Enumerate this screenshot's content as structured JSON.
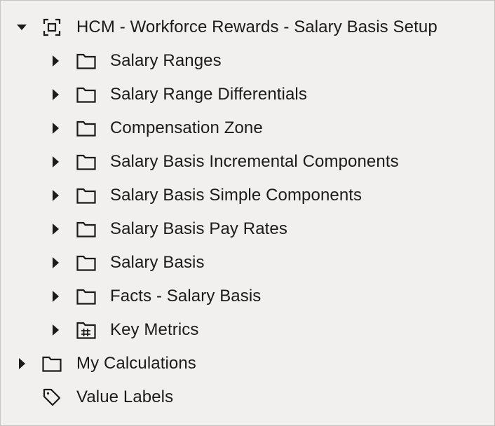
{
  "tree": {
    "root": {
      "label": "HCM - Workforce Rewards - Salary Basis Setup",
      "expanded": true,
      "icon": "subject-area-icon",
      "children": [
        {
          "label": "Salary Ranges",
          "icon": "folder-icon",
          "expanded": false
        },
        {
          "label": "Salary Range Differentials",
          "icon": "folder-icon",
          "expanded": false
        },
        {
          "label": "Compensation Zone",
          "icon": "folder-icon",
          "expanded": false
        },
        {
          "label": "Salary Basis Incremental Components",
          "icon": "folder-icon",
          "expanded": false
        },
        {
          "label": "Salary Basis Simple Components",
          "icon": "folder-icon",
          "expanded": false
        },
        {
          "label": "Salary Basis Pay Rates",
          "icon": "folder-icon",
          "expanded": false
        },
        {
          "label": "Salary Basis",
          "icon": "folder-icon",
          "expanded": false
        },
        {
          "label": "Facts - Salary Basis",
          "icon": "folder-icon",
          "expanded": false
        },
        {
          "label": "Key Metrics",
          "icon": "metrics-icon",
          "expanded": false
        }
      ]
    },
    "my_calculations": {
      "label": "My Calculations",
      "icon": "folder-icon",
      "expanded": false
    },
    "value_labels": {
      "label": "Value Labels",
      "icon": "tag-icon"
    }
  },
  "colors": {
    "background": "#f1f0ee",
    "text": "#1c1b1a",
    "border": "#c9c6c2"
  }
}
